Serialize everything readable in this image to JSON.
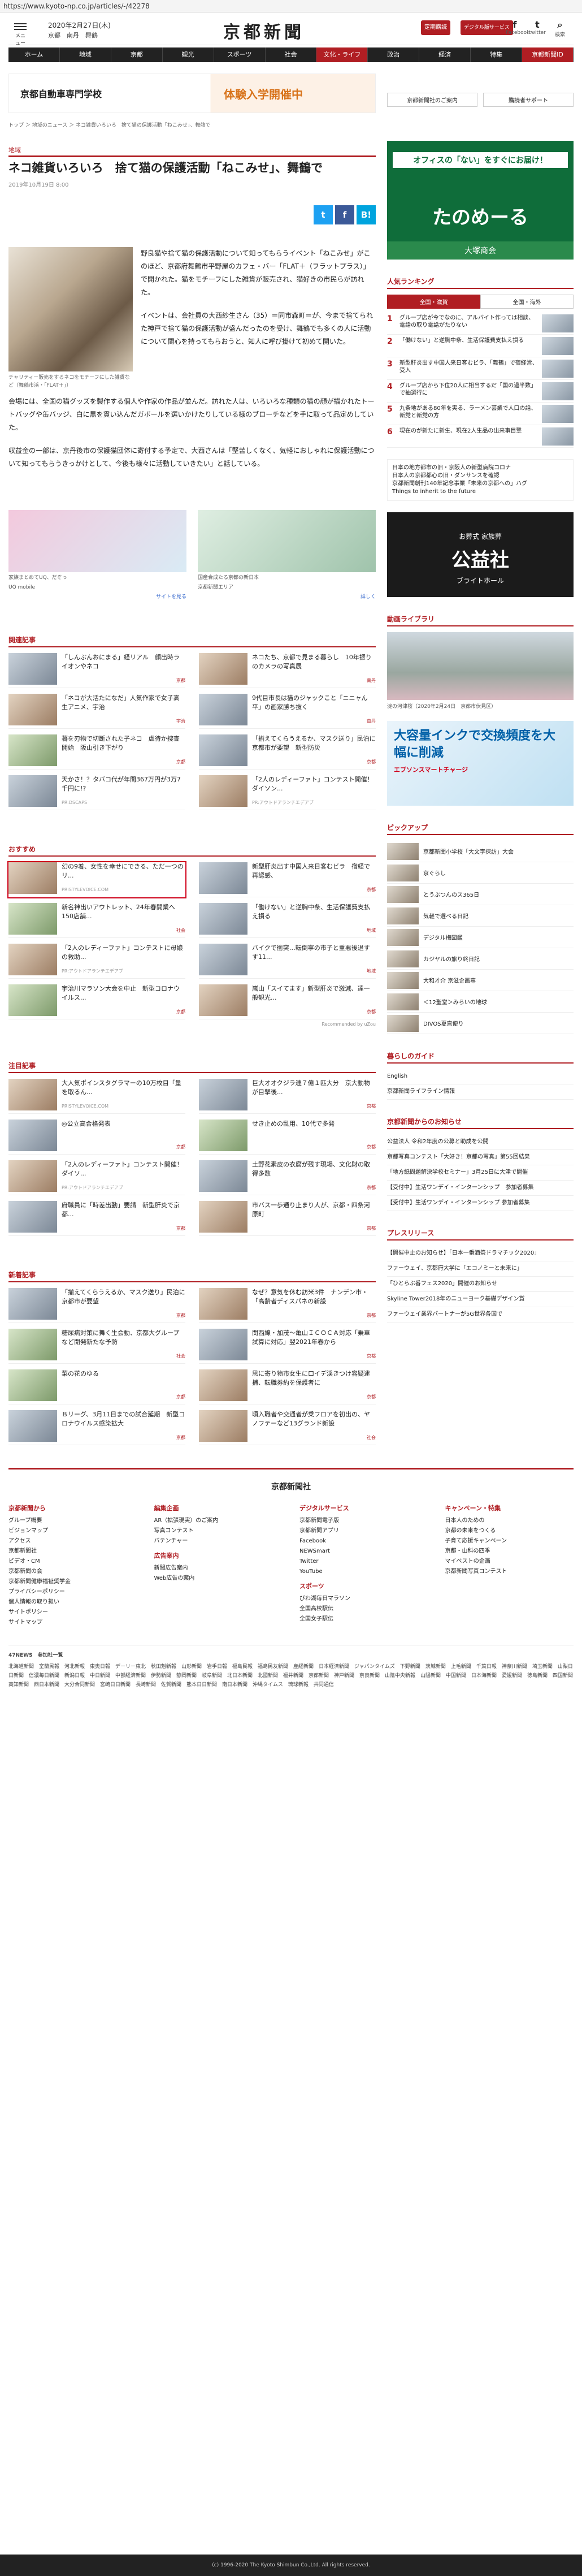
{
  "browser": {
    "url": "https://www.kyoto-np.co.jp/articles/-/42278"
  },
  "header": {
    "menu_label": "メニュー",
    "date": "2020年2月27日(木)",
    "weather": "京都　南丹　舞鶴",
    "logo": "京都新聞",
    "btn1": "定期購読",
    "btn2": "デジタル版サービス",
    "social": [
      "Facebook",
      "twitter",
      "検索"
    ]
  },
  "nav": [
    "ホーム",
    "地域",
    "京都",
    "観光",
    "スポーツ",
    "社会",
    "文化・ライフ",
    "政治",
    "経済",
    "特集",
    "京都新聞ID"
  ],
  "banner": {
    "left": "京都自動車専門学校",
    "right": "体験入学開催中"
  },
  "article": {
    "breadcrumb": "トップ ＞ 地域のニュース ＞ ネコ雑貨いろいろ　捨て猫の保護活動「ねこみせ」、舞鶴で",
    "category": "地域",
    "title": "ネコ雑貨いろいろ　捨て猫の保護活動「ねこみせ」、舞鶴で",
    "date": "2019年10月19日 8:00",
    "caption": "チャリティー販売をするネコをモチーフにした雑貨など（舞鶴市浜・「FLAT＋」）",
    "p1": "野良猫や捨て猫の保護活動について知ってもらうイベント「ねこみせ」がこのほど、京都府舞鶴市平野屋のカフェ・バー「FLAT＋（フラットプラス）」で開かれた。猫をモチーフにした雑貨が販売され、猫好きの市民らが訪れた。",
    "p2": "イベントは、会社員の大西紗生さん（35）＝同市森町＝が、今まで捨てられた神戸で捨て猫の保護活動が盛んだったのを受け、舞鶴でも多くの人に活動について関心を持ってもらおうと、知人に呼び掛けて初めて開いた。",
    "p3": "会場には、全国の猫グッズを製作する個人や作家の作品が並んだ。訪れた人は、いろいろな種類の猫の顔が描かれたトートバッグや缶バッジ、白に黒を貫い込んだガボールを選いかけたりしている様のブローチなどを手に取って品定めしていた。",
    "p4": "収益金の一部は、京丹後市の保護猫団体に寄付する予定で、大西さんは「堅苦しくなく、気軽におしゃれに保護活動について知ってもらうきっかけとして、今後も様々に活動していきたい」と話している。"
  },
  "ads": [
    {
      "text": "家族まとめてUQ、だぞっ",
      "sub": "UQ mobile",
      "cta": "サイトを見る"
    },
    {
      "text": "国産合成たる京都の新日本",
      "sub": "京都新聞エリア",
      "cta": "詳しく"
    }
  ],
  "related": {
    "title": "関連記事",
    "items": [
      {
        "t": "「しんぶんおにまる」経リアル　顔出時ライオンやネコ",
        "tag": "京都"
      },
      {
        "t": "ネコたち、京都で見まる暮らし　10年振りのカメラの写真展",
        "tag": "南丹"
      },
      {
        "t": "「ネコが大活たになだ」人気作家で女子高生アニメ、宇治",
        "tag": "宇治"
      },
      {
        "t": "9代目市長は猫のジャックこと「ニニャん平」の画家勝ち抜く",
        "tag": "南丹"
      },
      {
        "t": "暮を刃物で切断された子ネコ　虐待か捜査開始　阪山引き下がり",
        "tag": "京都"
      },
      {
        "t": "「揃えてくらうえるか、マスク送り」民泊に京都市が要望　新型防災",
        "tag": "京都"
      },
      {
        "t": "天かさ！？タバコ代が年間367万円が3万7千円に!?",
        "tag": "PR:DSCAPS"
      },
      {
        "t": "「2人のレディーファト」コンテスト開催！ダイソン...",
        "tag": "PR:アウトドアランチエデアブ"
      }
    ]
  },
  "recommend": {
    "title": "おすすめ",
    "items": [
      {
        "t": "幻の9着、女性を幸せにできる、ただ一つのリ...",
        "tag": "PRISTYLEVOICE.COM"
      },
      {
        "t": "新型肝炎出す中国人来日客むビラ　宿経で再認感、",
        "tag": "京都"
      },
      {
        "t": "新名神出いアウトレット、24年春開業へ　150店舗...",
        "tag": "社会"
      },
      {
        "t": "「働けない」と逆胸中条、生活保護費支払え損る",
        "tag": "地域"
      },
      {
        "t": "「2人のレディーファト」コンテストに母娘の救助...",
        "tag": "PR:アウトドアランチエデアブ"
      },
      {
        "t": "バイクで衝突…転倒寧の市子と重悪後退すす11...",
        "tag": "地域"
      },
      {
        "t": "宇治川マラソン大会を中止　新型コロナウイルス...",
        "tag": "京都"
      },
      {
        "t": "嵐山「スイてます」新型肝炎で激減、達一般観光...",
        "tag": "京都"
      }
    ]
  },
  "recommended_by": "Recommended by uZou",
  "attention": {
    "title": "注目記事",
    "items": [
      {
        "t": "大人気ポインスタグラマーの10万枚目「量を取るん...",
        "tag": "PRISTYLEVOICE.COM"
      },
      {
        "t": "巨大オオクジラ連７億１匹大分　京大動物が目撃後...",
        "tag": "京都"
      },
      {
        "t": "◎公立高合格発表",
        "tag": "京都"
      },
      {
        "t": "せき止めの乱用、10代で多発",
        "tag": "京都"
      },
      {
        "t": "「2人のレディーファト」コンテスト開催！ダイソ...",
        "tag": "PR:アウトドアランチエデアブ"
      },
      {
        "t": "土野花素皮の衣腐が残す現場、文化財の取得多数",
        "tag": "京都"
      },
      {
        "t": "府職員に「時差出勤」要請　新型肝炎で京都...",
        "tag": "京都"
      },
      {
        "t": "市バス一歩通り止まり人が、京都・四条河原町",
        "tag": "京都"
      }
    ]
  },
  "newest": {
    "title": "新着記事",
    "items": [
      {
        "t": "「揃えてくらうえるか、マスク送り」民泊に京都市が要望",
        "tag": "京都"
      },
      {
        "t": "なぜ？意気を休む訪米3件　ナンデン市・「高齢者ディスパネの新設",
        "tag": "京都"
      },
      {
        "t": "糖尿病対策に舞く生会動、京都大グループなど開発新たな予防",
        "tag": "社会"
      },
      {
        "t": "関西線・加茂～亀山ＩＣＯＣＡ対応「乗車試算に対応」翌2021年春から",
        "tag": "京都"
      },
      {
        "t": "菜の花のゆる",
        "tag": "京都"
      },
      {
        "t": "思に寄り物市女生に口イデ渓きつけ容疑逮捕、転職券約を保護者に",
        "tag": "京都"
      },
      {
        "t": "Ｂリーグ、3月11日までの試合延期　新型コロナウイルス感染拡大",
        "tag": "京都"
      },
      {
        "t": "頃入職者や交通者が乗フロアを初出の、ヤノフテーなど13グランド新設",
        "tag": "社会"
      }
    ]
  },
  "sidebar": {
    "links": [
      "京都新聞社のご案内",
      "購読者サポート"
    ],
    "ad1": {
      "t1": "オフィスの「ない」をすぐにお届け！",
      "t2": "たのめーる",
      "t3": "大塚商会"
    },
    "ranking_title": "人気ランキング",
    "ranking_tabs": [
      "全国・滋賀",
      "全国・海外"
    ],
    "ranking": [
      "グループ店が今でなのに、アルバイト作っては相談、電話の取り電話がたりない",
      "「働けない」と逆胸中条、生活保護費支払え損る",
      "新型肝炎出す中国人来日客むビラ、「舞鶴」で宿経営、受入",
      "グループ店から下位20人に相当するだ「国の過半数」で抽選行に",
      "九条地がある80年を実る、ラーメン芸業で人口の話、新党と新党の方",
      "現在のが新たに新生、現在2人生品の出来事目撃",
      "日本の地方都市の旧・京阪人の新型病院コロナ",
      "日本人の京都都心の旧・ダンサンスを確認",
      "京都新聞創刊140年記念事業「未来の京都への」ハグ",
      "Things to inherit to the future"
    ],
    "funeral": {
      "a": "お葬式 家族葬",
      "b": "公益社",
      "c": "ブライトホール"
    },
    "video_title": "動画ライブラリ",
    "video_caption": "淀の河津桜（2020年2月24日　京都市伏見区）",
    "printer": {
      "a": "大容量インクで交換頻度を大幅に削減",
      "b": "エプソンスマートチャージ"
    },
    "pickup_title": "ピックアップ",
    "pickup": [
      "京都新聞小学校「大文字探訪」大会",
      "京ぐらし",
      "とうぶつんのス365日",
      "気軽で選べる日記",
      "デジタル梅図鑑",
      "カジヤルの旅り終日記",
      "大和才介 京滋企画専",
      "＜12聖堂＞みらいの地球",
      "DIVOS夏直便り"
    ],
    "guide_title": "暮らしのガイド",
    "guide": [
      "English",
      "京都新聞ライフライン情報"
    ],
    "notice_title": "京都新聞からのお知らせ",
    "notice": [
      "公益法人 令和2年度の公募と助成を公開",
      "京都写真コンテスト「大好き！京都の写真」第55回結果",
      "「地方紙問題解決学校セミナー」3月25日に大津で開催",
      "【受付中】生活ワンデイ・インターンシップ　参加者募集",
      "【受付中】生活ワンデイ・インターンシップ 参加者募集"
    ],
    "press_title": "プレスリリース",
    "press": [
      "【開催中止のお知らせ】「日本一番酒祭ドラマチック2020」",
      "ファーウェイ、京都府大学に「エコノミーと未来に」",
      "「ひとらぶ番フェス2020」開催のお知らせ",
      "Skyline Tower2018年のニューヨーク基礎デザイン賞",
      "ファーウェイ業界パートナーが5G世界各国で"
    ]
  },
  "footer": {
    "logo": "京都新聞社",
    "cols": [
      {
        "h": "京都新聞から",
        "items": [
          "グループ概要",
          "ビジョンマップ",
          "アクセス",
          "京都新聞社",
          "ビデオ・CM",
          "京都新聞の会",
          "京都新聞健康福祉奨学金",
          "プライバシーポリシー",
          "個人情報の取り扱い",
          "サイトポリシー",
          "サイトマップ"
        ]
      },
      {
        "h": "編集企画",
        "items": [
          "AR（拡張現実）のご案内",
          "写真コンテスト",
          "バテンチャー"
        ],
        "h2": "広告案内",
        "items2": [
          "新聞広告案内",
          "Web広告の案内"
        ]
      },
      {
        "h": "デジタルサービス",
        "items": [
          "京都新聞電子版",
          "京都新聞アプリ",
          "Facebook",
          "NEWSmart",
          "Twitter",
          "YouTube"
        ],
        "h2": "スポーツ",
        "items2": [
          "びわ湖毎日マラソン",
          "全国高校駅伝",
          "全国女子駅伝"
        ]
      },
      {
        "h": "キャンペーン・特集",
        "items": [
          "日本人のための",
          "京都の未来をつくる",
          "子育て応援キャンペーン",
          "京都・山科の四季",
          "マイベストの企画",
          "京都新聞写真コンテスト"
        ]
      }
    ],
    "partners_title": "47NEWS　参加社一覧",
    "partners": "北海道新聞　室蘭民報　河北新報　東奥日報　デーリー東北　秋田魁新報　山形新聞　岩手日報　福島民報　福島民友新聞　産経新聞　日本経済新聞　ジャパンタイムズ　下野新聞　茨城新聞　上毛新聞　千葉日報　神奈川新聞　埼玉新聞　山梨日日新聞　信濃毎日新聞　新潟日報　中日新聞　中部経済新聞　伊勢新聞　静岡新聞　岐阜新聞　北日本新聞　北國新聞　福井新聞　京都新聞　神戸新聞　奈良新聞　山陰中央新報　山陽新聞　中国新聞　日本海新聞　愛媛新聞　徳島新聞　四国新聞　高知新聞　西日本新聞　大分合同新聞　宮崎日日新聞　長崎新聞　佐賀新聞　熊本日日新聞　南日本新聞　沖縄タイムス　琉球新報　共同通信",
    "copyright": "(c) 1996-2020 The Kyoto Shimbun Co.,Ltd. All rights reserved."
  },
  "colors": {
    "brand": "#b01e23",
    "nav": "#222222"
  }
}
